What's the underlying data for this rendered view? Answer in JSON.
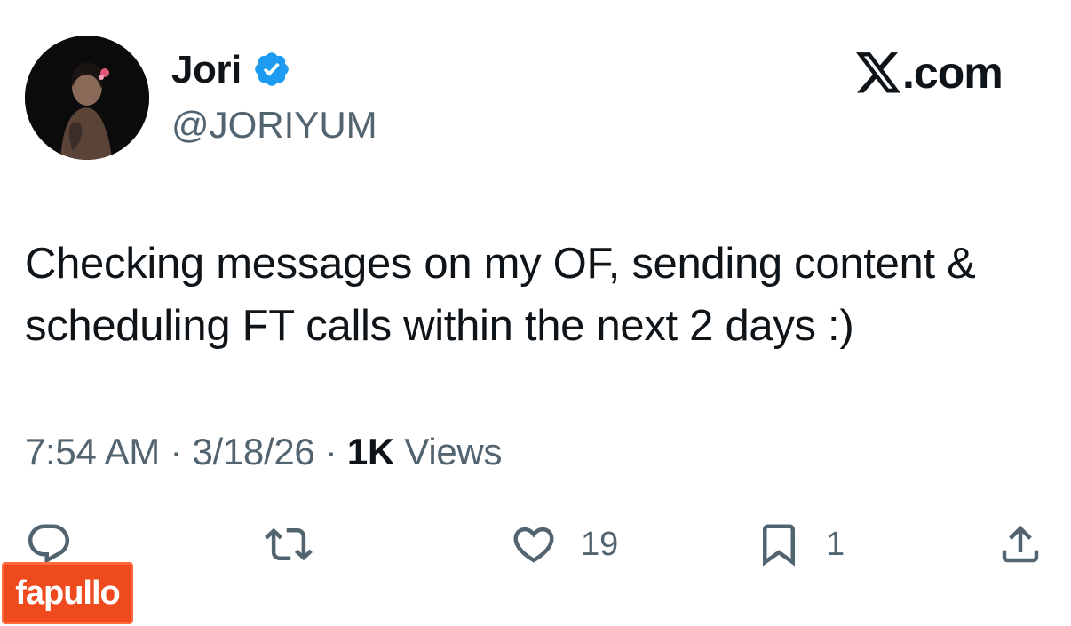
{
  "author": {
    "display_name": "Jori",
    "handle": "@JORIYUM",
    "verified": true,
    "avatar": "profile-photo"
  },
  "brand": {
    "logo": "x-logo",
    "domain_suffix": ".com"
  },
  "tweet": {
    "text": "Checking messages on my OF, sending content & scheduling FT calls within the next 2 days :)",
    "time": "7:54 AM",
    "date": "3/18/26",
    "views_count": "1K",
    "views_label": "Views",
    "separator": "·"
  },
  "actions": {
    "reply": {
      "icon": "reply-icon",
      "count": ""
    },
    "retweet": {
      "icon": "retweet-icon",
      "count": ""
    },
    "like": {
      "icon": "heart-icon",
      "count": "19"
    },
    "bookmark": {
      "icon": "bookmark-icon",
      "count": "1"
    },
    "share": {
      "icon": "share-icon",
      "count": ""
    }
  },
  "watermark": {
    "text": "fapullo"
  },
  "colors": {
    "text_primary": "#0f1419",
    "text_secondary": "#536471",
    "verified_blue": "#1d9bf0",
    "watermark_bg": "#ef4a1e"
  }
}
